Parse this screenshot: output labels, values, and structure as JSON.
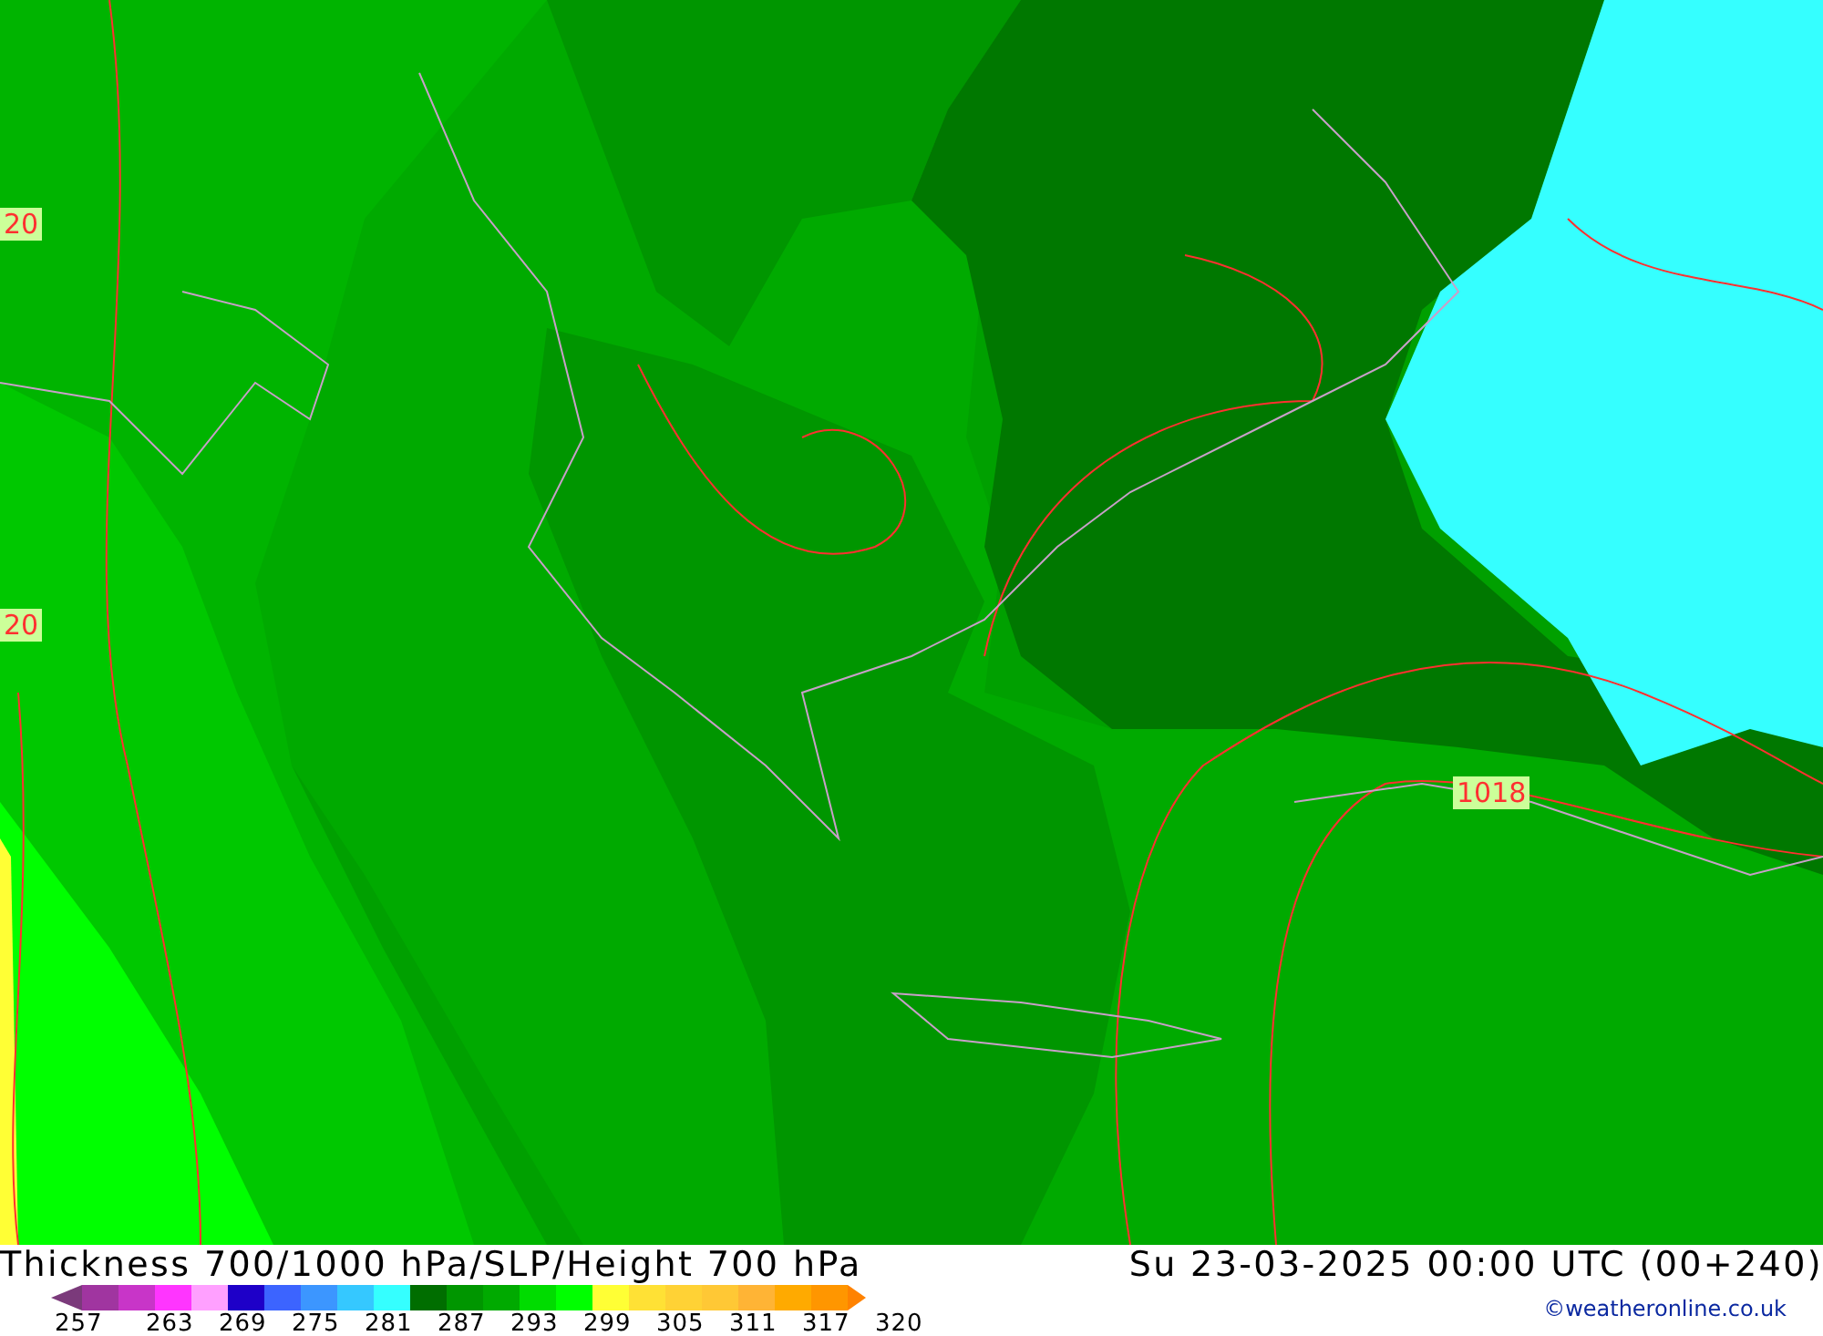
{
  "map": {
    "labels": [
      "20",
      "20",
      "1018"
    ]
  },
  "title": "Thickness 700/1000 hPa/SLP/Height 700 hPa",
  "timestamp": "Su 23-03-2025 00:00 UTC (00+240)",
  "legend": {
    "swatches": [
      {
        "kind": "low-arrow",
        "color": "#7b3a7b"
      },
      {
        "kind": "band",
        "color": "#a035a0"
      },
      {
        "kind": "band",
        "color": "#c835c8"
      },
      {
        "kind": "band",
        "color": "#ff35ff"
      },
      {
        "kind": "band",
        "color": "#ffa0ff"
      },
      {
        "kind": "band",
        "color": "#1e00c8"
      },
      {
        "kind": "band",
        "color": "#3c64ff"
      },
      {
        "kind": "band",
        "color": "#3c96ff"
      },
      {
        "kind": "band",
        "color": "#35c8ff"
      },
      {
        "kind": "band",
        "color": "#35ffff"
      },
      {
        "kind": "band",
        "color": "#006e00"
      },
      {
        "kind": "band",
        "color": "#009600"
      },
      {
        "kind": "band",
        "color": "#00aa00"
      },
      {
        "kind": "band",
        "color": "#00dc00"
      },
      {
        "kind": "band",
        "color": "#00ff00"
      },
      {
        "kind": "band",
        "color": "#ffff35"
      },
      {
        "kind": "band",
        "color": "#ffe135"
      },
      {
        "kind": "band",
        "color": "#ffd235"
      },
      {
        "kind": "band",
        "color": "#ffc835"
      },
      {
        "kind": "band",
        "color": "#ffb435"
      },
      {
        "kind": "band",
        "color": "#ffaa00"
      },
      {
        "kind": "band",
        "color": "#ff9600"
      },
      {
        "kind": "high-arrow",
        "color": "#ff8200"
      }
    ],
    "ticks": [
      "257",
      "263",
      "269",
      "275",
      "281",
      "287",
      "293",
      "299",
      "305",
      "311",
      "317",
      "320"
    ]
  },
  "copyright": "©weatheronline.co.uk"
}
